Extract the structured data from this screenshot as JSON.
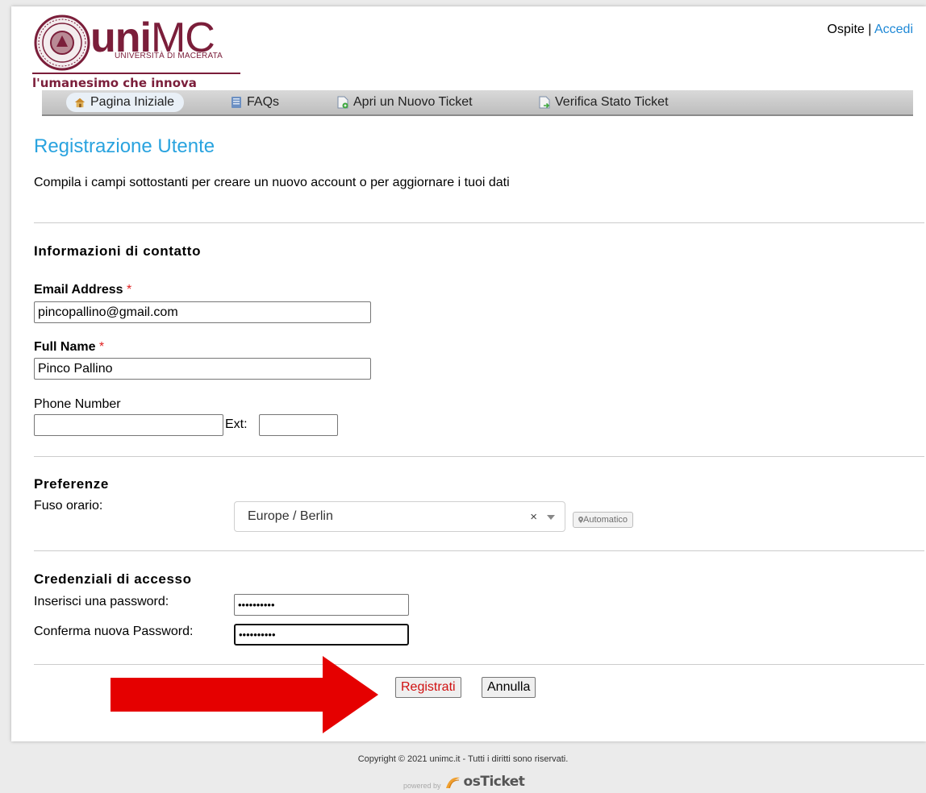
{
  "header": {
    "logo_word_bold": "uni",
    "logo_word_light": "MC",
    "university": "UNIVERSITÀ DI MACERATA",
    "tagline": "l'umanesimo che innova",
    "user_guest": "Ospite",
    "user_separator": " | ",
    "user_login": "Accedi"
  },
  "nav": {
    "items": [
      {
        "label": "Pagina Iniziale",
        "icon": "home-icon"
      },
      {
        "label": "FAQs",
        "icon": "book-icon"
      },
      {
        "label": "Apri un Nuovo Ticket",
        "icon": "new-ticket-icon"
      },
      {
        "label": "Verifica Stato Ticket",
        "icon": "ticket-status-icon"
      }
    ]
  },
  "page": {
    "title": "Registrazione Utente",
    "intro": "Compila i campi sottostanti per creare un nuovo account o per aggiornare i tuoi dati"
  },
  "contact": {
    "title": "Informazioni di contatto",
    "email_label": "Email Address",
    "email_value": "pincopallino@gmail.com",
    "name_label": "Full Name",
    "name_value": "Pinco Pallino",
    "phone_label": "Phone Number",
    "phone_value": "",
    "ext_label": "Ext:",
    "ext_value": "",
    "required_mark": "*"
  },
  "preferences": {
    "title": "Preferenze",
    "timezone_label": "Fuso orario:",
    "timezone_value": "Europe / Berlin",
    "clear_symbol": "×",
    "auto_button": "Automatico",
    "auto_icon": "map-pin-icon"
  },
  "credentials": {
    "title": "Credenziali di accesso",
    "password_label": "Inserisci una password:",
    "password_value": "••••••••••",
    "confirm_label": "Conferma nuova Password:",
    "confirm_value": "••••••••••"
  },
  "actions": {
    "register": "Registrati",
    "cancel": "Annulla"
  },
  "annotation": {
    "arrow_color": "#e50000"
  },
  "footer": {
    "copyright": "Copyright © 2021 unimc.it - Tutti i diritti sono riservati.",
    "powered_by": "powered by",
    "brand_prefix": "os",
    "brand_suffix": "Ticket"
  },
  "colors": {
    "accent": "#29a3df",
    "brand": "#7b1e3a",
    "required": "#e02020",
    "register_text": "#d01010"
  }
}
